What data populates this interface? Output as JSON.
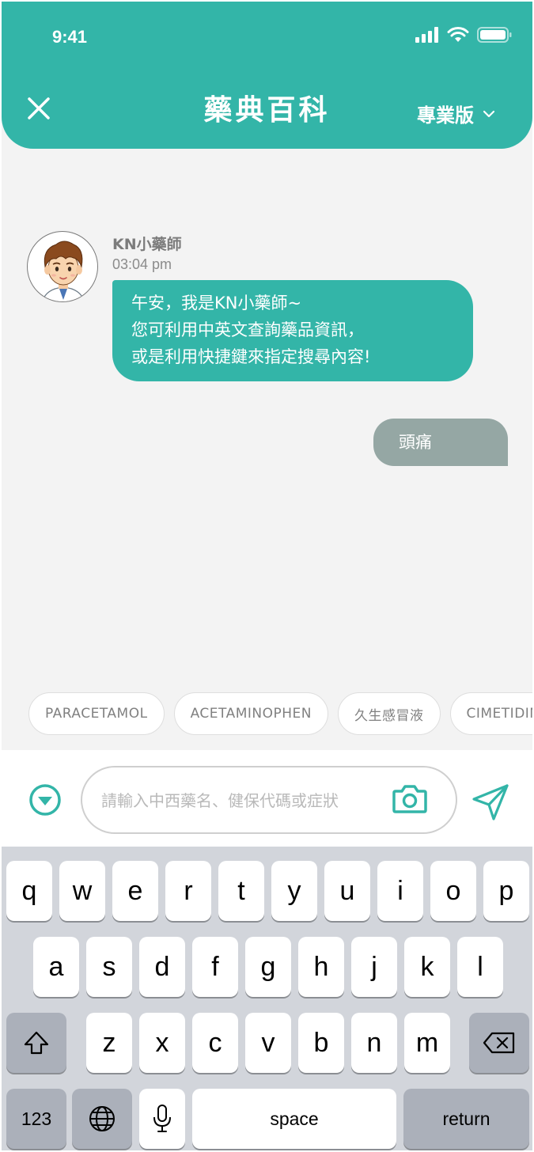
{
  "status_bar": {
    "time": "9:41"
  },
  "header": {
    "title": "藥典百科",
    "edition_label": "專業版"
  },
  "chat": {
    "bot": {
      "name": "KN小藥師",
      "time": "03:04 pm",
      "lines": [
        "午安，我是KN小藥師~",
        "您可利用中英文查詢藥品資訊，",
        "或是利用快捷鍵來指定搜尋內容!"
      ]
    },
    "user": {
      "text": "頭痛"
    }
  },
  "quick_chips": [
    "PARACETAMOL",
    "ACETAMINOPHEN",
    "久生感冒液",
    "CIMETIDINE"
  ],
  "input": {
    "placeholder": "請輸入中西藥名、健保代碼或症狀",
    "value": ""
  },
  "keyboard": {
    "row1": [
      "q",
      "w",
      "e",
      "r",
      "t",
      "y",
      "u",
      "i",
      "o",
      "p"
    ],
    "row2": [
      "a",
      "s",
      "d",
      "f",
      "g",
      "h",
      "j",
      "k",
      "l"
    ],
    "row3": [
      "z",
      "x",
      "c",
      "v",
      "b",
      "n",
      "m"
    ],
    "numbers_label": "123",
    "space_label": "space",
    "return_label": "return"
  },
  "colors": {
    "accent": "#33b5a8",
    "user_bubble": "#95a7a4",
    "background": "#f3f3f3"
  },
  "icons": [
    "signal-icon",
    "wifi-icon",
    "battery-icon",
    "close-icon",
    "chevron-down-icon",
    "toggle-down-icon",
    "camera-icon",
    "send-icon",
    "shift-icon",
    "backspace-icon",
    "globe-icon",
    "microphone-icon"
  ]
}
